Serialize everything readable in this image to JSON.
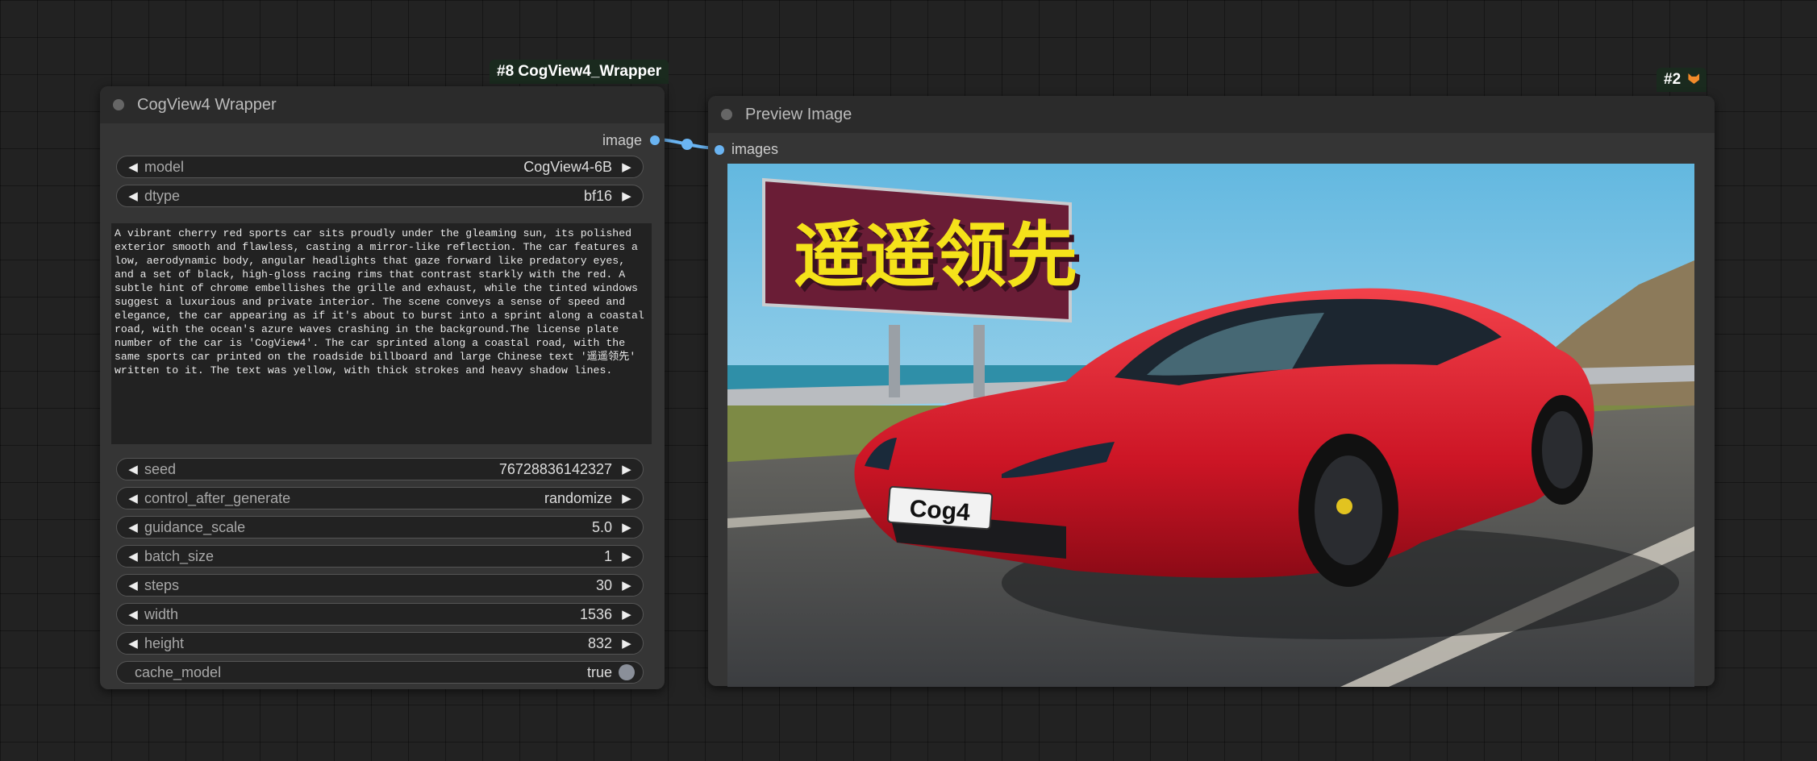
{
  "nodes": {
    "wrapper": {
      "badge": "#8 CogView4_Wrapper",
      "title": "CogView4 Wrapper",
      "output_label": "image",
      "widgets": {
        "model": {
          "label": "model",
          "value": "CogView4-6B"
        },
        "dtype": {
          "label": "dtype",
          "value": "bf16"
        },
        "seed": {
          "label": "seed",
          "value": "76728836142327"
        },
        "control_after_generate": {
          "label": "control_after_generate",
          "value": "randomize"
        },
        "guidance_scale": {
          "label": "guidance_scale",
          "value": "5.0"
        },
        "batch_size": {
          "label": "batch_size",
          "value": "1"
        },
        "steps": {
          "label": "steps",
          "value": "30"
        },
        "width": {
          "label": "width",
          "value": "1536"
        },
        "height": {
          "label": "height",
          "value": "832"
        },
        "cache_model": {
          "label": "cache_model",
          "value": "true"
        }
      },
      "prompt": "A vibrant cherry red sports car sits proudly under the gleaming sun, its polished exterior smooth and flawless, casting a mirror-like reflection. The car features a low, aerodynamic body, angular headlights that gaze forward like predatory eyes, and a set of black, high-gloss racing rims that contrast starkly with the red. A subtle hint of chrome embellishes the grille and exhaust, while the tinted windows suggest a luxurious and private interior. The scene conveys a sense of speed and elegance, the car appearing as if it's about to burst into a sprint along a coastal road, with the ocean's azure waves crashing in the background.The license plate number of the car is 'CogView4'. The car sprinted along a coastal road, with the same sports car printed on the roadside billboard and large Chinese text '遥遥领先' written to it. The text was yellow, with thick strokes and heavy shadow lines."
    },
    "preview": {
      "badge": "#2",
      "badge_icon": "fox-icon",
      "title": "Preview Image",
      "input_label": "images",
      "image": {
        "billboard_text": "遥遥领先",
        "plate_text": "Cog4"
      }
    }
  },
  "colors": {
    "link": "#6ab4f2",
    "background": "#222222",
    "node": "#353535",
    "car_red": "#d41a2a",
    "billboard_text": "#f5e21a"
  }
}
